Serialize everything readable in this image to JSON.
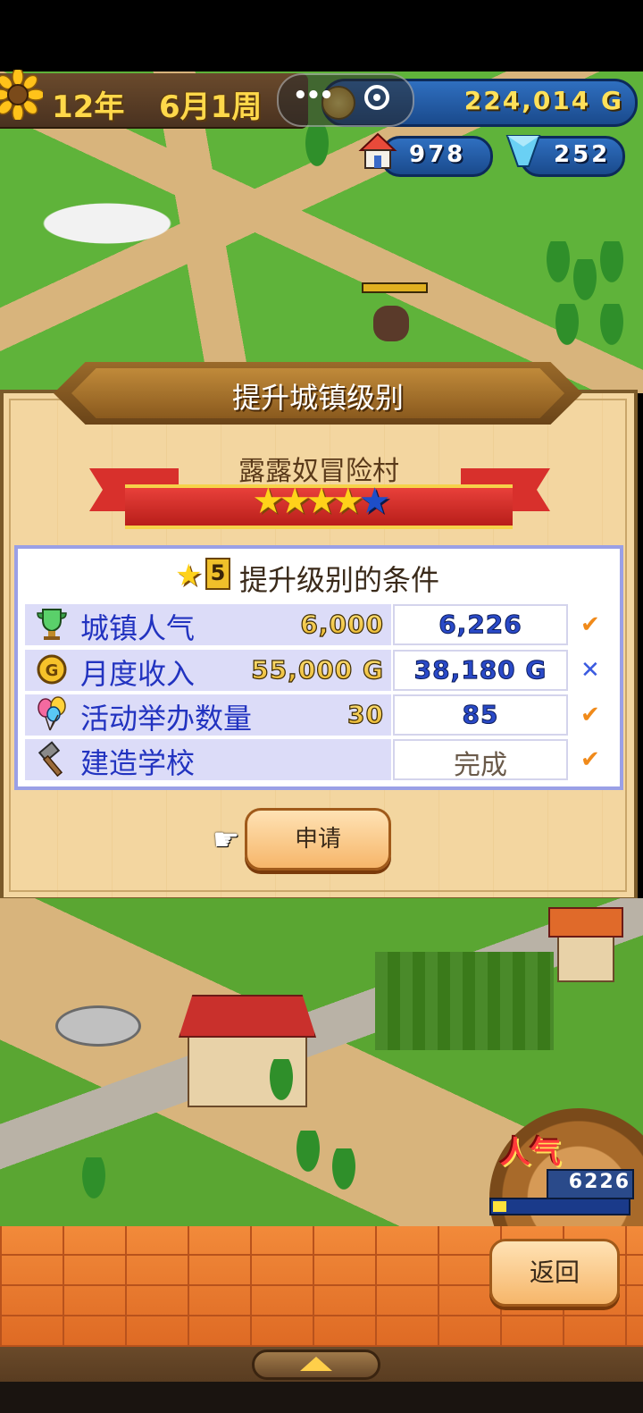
{
  "hud": {
    "year": "12年",
    "month_week": "6月1周",
    "gold": "224,014 G",
    "houses": "978",
    "crystals": "252"
  },
  "panel": {
    "title": "提升城镇级别",
    "town_name": "露露奴冒险村",
    "rating_filled": 4,
    "rating_total": 5,
    "conditions_level": "5",
    "conditions_title": "提升级别的条件",
    "conditions": [
      {
        "icon": "trophy-icon",
        "label": "城镇人气",
        "required": "6,000",
        "current": "6,226",
        "met": true
      },
      {
        "icon": "coin-icon",
        "label": "月度收入",
        "required": "55,000 G",
        "current": "38,180 G",
        "met": false
      },
      {
        "icon": "balloon-icon",
        "label": "活动举办数量",
        "required": "30",
        "current": "85",
        "met": true
      },
      {
        "icon": "hammer-icon",
        "label": "建造学校",
        "required": "",
        "current": "完成",
        "met": true
      }
    ],
    "apply_label": "申请"
  },
  "popularity": {
    "label": "人气",
    "value": "6226",
    "fill_fraction": 0.1
  },
  "footer": {
    "back_label": "返回"
  },
  "marks": {
    "check": "✔",
    "cross": "✕"
  }
}
